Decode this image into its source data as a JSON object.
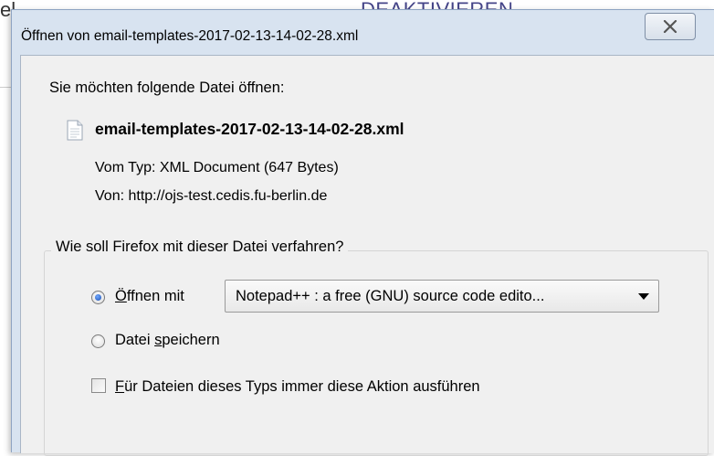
{
  "background": {
    "left_text": "el",
    "right_text": "DEAKTIVIEREN"
  },
  "dialog": {
    "title": "Öffnen von email-templates-2017-02-13-14-02-28.xml",
    "prompt": "Sie möchten folgende Datei öffnen:",
    "file": {
      "name": "email-templates-2017-02-13-14-02-28.xml",
      "type_line": "Vom Typ: XML Document (647 Bytes)",
      "from_line": "Von: http://ojs-test.cedis.fu-berlin.de"
    },
    "group": {
      "legend": "Wie soll Firefox mit dieser Datei verfahren?",
      "open_with": {
        "label_accel": "Ö",
        "label_rest": "ffnen mit",
        "checked": true,
        "selected_app": "Notepad++ : a free (GNU) source code edito..."
      },
      "save": {
        "label_pre": "Datei ",
        "label_accel": "s",
        "label_rest": "peichern",
        "checked": false
      },
      "always": {
        "label_accel": "F",
        "label_rest": "ür Dateien dieses Typs immer diese Aktion ausführen",
        "checked": false
      }
    }
  },
  "icons": [
    "close-icon",
    "file-icon",
    "dropdown-arrow-icon"
  ],
  "colors": {
    "dialog_frame": "#d8e3f0",
    "content_bg": "#f0f0f0",
    "radio_dot": "#1e4fb0"
  }
}
